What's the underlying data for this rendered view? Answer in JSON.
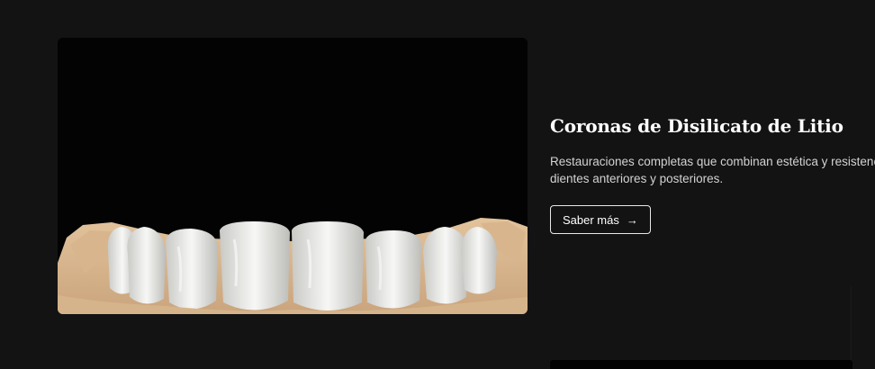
{
  "service": {
    "title": "Coronas de Disilicato de Litio",
    "description": "Restauraciones completas que combinan estética y resistencia para dientes anteriores y posteriores.",
    "cta_label": "Saber más",
    "cta_icon": "arrow-right-icon",
    "cta_arrow": "→",
    "image_subject": "dental-crowns-photo"
  },
  "colors": {
    "background": "#131313",
    "image_background": "#030303",
    "title": "#ffffff",
    "text": "#d3d3d3",
    "button_border": "#e9e9e9"
  }
}
